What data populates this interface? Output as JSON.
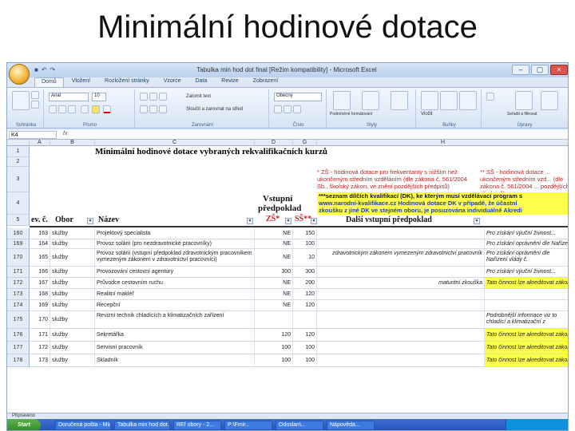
{
  "slide": {
    "title": "Minimální hodinové dotace"
  },
  "window": {
    "title": "Tabulka min hod dot final [Režim kompatibility] - Microsoft Excel",
    "controls": [
      "–",
      "▢",
      "×"
    ]
  },
  "ribbon": {
    "tabs": [
      "Domů",
      "Vložení",
      "Rozložení stránky",
      "Vzorce",
      "Data",
      "Revize",
      "Zobrazení"
    ],
    "active_tab": "Domů",
    "groups": [
      "Schránka",
      "Písmo",
      "Zarovnání",
      "Číslo",
      "Styly",
      "Buňky",
      "Úpravy"
    ],
    "font_name": "Arial",
    "font_size": "10",
    "number_format": "Obecný",
    "buttons": {
      "wrap": "Zalomit text",
      "merge": "Sloučit a zarovnat na střed",
      "cond_format": "Podmíněné formátování",
      "format_table": "Formátovat jako tabulku",
      "cell_styles": "Styly buňky",
      "insert": "Vložit",
      "delete": "Odstranit",
      "format": "Formát",
      "sort": "Seřadit a filtrovat",
      "find": "Najít a vybrat"
    }
  },
  "formula_bar": {
    "cell": "K4",
    "fx": "fx"
  },
  "columns": [
    "A",
    "B",
    "C",
    "D",
    "G",
    "H"
  ],
  "sheet": {
    "title": "Minimální hodinové dotace vybraných rekvalifikačních kurzů",
    "note_zs": "* ZŠ - hodinová dotace pro frekventanty s nižším než ukončeným středním vzděláním (dle zákona č. 561/2004 Sb., školský zákon, ve znění pozdějších předpisů)",
    "note_ss": "** SŠ - hodinová dotace ... ukončeným středním vzd... (dle zákona č. 561/2004 ... pozdějších předpisů)",
    "note_dk": "***seznam dílčích kvalifikací (DK), ke kterým musí vzdělávací program s",
    "note_dk2": "www.narodni-kvalifikace.cz   Hodinová dotace DK v případě, že účastní",
    "note_dk3": "zkoušku z jiné DK ve stejném oboru, je posuzována individuálně Akredi",
    "hdr_vstupni": "Vstupní",
    "hdr_predpoklad": "předpoklad",
    "hdr_ev": "ev. č.",
    "hdr_obor": "Obor",
    "hdr_nazev": "Název",
    "hdr_zs": "ZŠ*",
    "hdr_ss": "SŠ**",
    "hdr_dalsi": "Další vstupní předpoklad"
  },
  "top_row_numbers": [
    "1",
    "2",
    "3",
    "4",
    "5"
  ],
  "rows": [
    {
      "row": "160",
      "ev": "163",
      "obor": "služby",
      "nazev": "Projektový specialista",
      "zs": "NE",
      "ss": "150",
      "dalsi": "",
      "note": "Pro získání výuční živnost...",
      "yellow": false
    },
    {
      "row": "169",
      "ev": "164",
      "obor": "služby",
      "nazev": "Provoz solárií (pro nezdravotnické pracovníky)",
      "zs": "NE",
      "ss": "100",
      "dalsi": "",
      "note": "Pro získání oprávnění dle Nařízení vlády č.",
      "yellow": false
    },
    {
      "row": "170",
      "ev": "165",
      "obor": "služby",
      "nazev": "Provoz solárií (vstupní předpoklad zdravotnickým pracovníkem vymezeným zákonem v zdravotnictví pracovníci)",
      "zs": "NE",
      "ss": "10",
      "dalsi": "zdravotnickým zákonem vymezeným zdravotnictví pracovník",
      "note": "Pro získání oprávnění dle Nařízení vlády č.",
      "yellow": false
    },
    {
      "row": "171",
      "ev": "166",
      "obor": "služby",
      "nazev": "Provozování cestovní agentury",
      "zs": "300",
      "ss": "300",
      "dalsi": "",
      "note": "Pro získání výuční živnost...",
      "yellow": false
    },
    {
      "row": "172",
      "ev": "167",
      "obor": "služby",
      "nazev": "Průvodce cestovním ruchu",
      "zs": "NE",
      "ss": "200",
      "dalsi": "maturitní zkouška",
      "note": "Tato činnost lze akreditovat zákona č. 179/2006 Sb.",
      "yellow": true
    },
    {
      "row": "173",
      "ev": "168",
      "obor": "služby",
      "nazev": "Realitní makléř",
      "zs": "NE",
      "ss": "120",
      "dalsi": "",
      "note": "",
      "yellow": false
    },
    {
      "row": "174",
      "ev": "169",
      "obor": "služby",
      "nazev": "Recepční",
      "zs": "NE",
      "ss": "120",
      "dalsi": "",
      "note": "",
      "yellow": false
    },
    {
      "row": "175",
      "ev": "170",
      "obor": "služby",
      "nazev": "Revizní technik chladících a klimatizačních zařízení",
      "zs": "",
      "ss": "",
      "dalsi": "",
      "note": "Podrobnější informace viz to chladící a klimatizační z",
      "yellow": false
    },
    {
      "row": "176",
      "ev": "171",
      "obor": "služby",
      "nazev": "Sekretářka",
      "zs": "120",
      "ss": "120",
      "dalsi": "",
      "note": "Tato činnost lze akreditovat zákona č. 179/2006 Sb. a vyk",
      "yellow": true
    },
    {
      "row": "177",
      "ev": "172",
      "obor": "služby",
      "nazev": "Servisní pracovník",
      "zs": "100",
      "ss": "100",
      "dalsi": "",
      "note": "Tato činnost lze akreditovat zákona č. 179/2006 Sb. a vyk",
      "yellow": true
    },
    {
      "row": "178",
      "ev": "173",
      "obor": "služby",
      "nazev": "Skladník",
      "zs": "100",
      "ss": "100",
      "dalsi": "",
      "note": "Tato činnost lze akreditovat zákona č. 179/2006 Sb. a vyk",
      "yellow": true
    }
  ],
  "sheet_tab": "Připraveno",
  "taskbar": {
    "start": "Start",
    "tasks": [
      "Doručená pošta - Micr...",
      "Tabulka min hod dot...",
      "REf obory - 2...",
      "P:\\Fmir...",
      "Odoslan\\...",
      "Nápověda..."
    ]
  }
}
